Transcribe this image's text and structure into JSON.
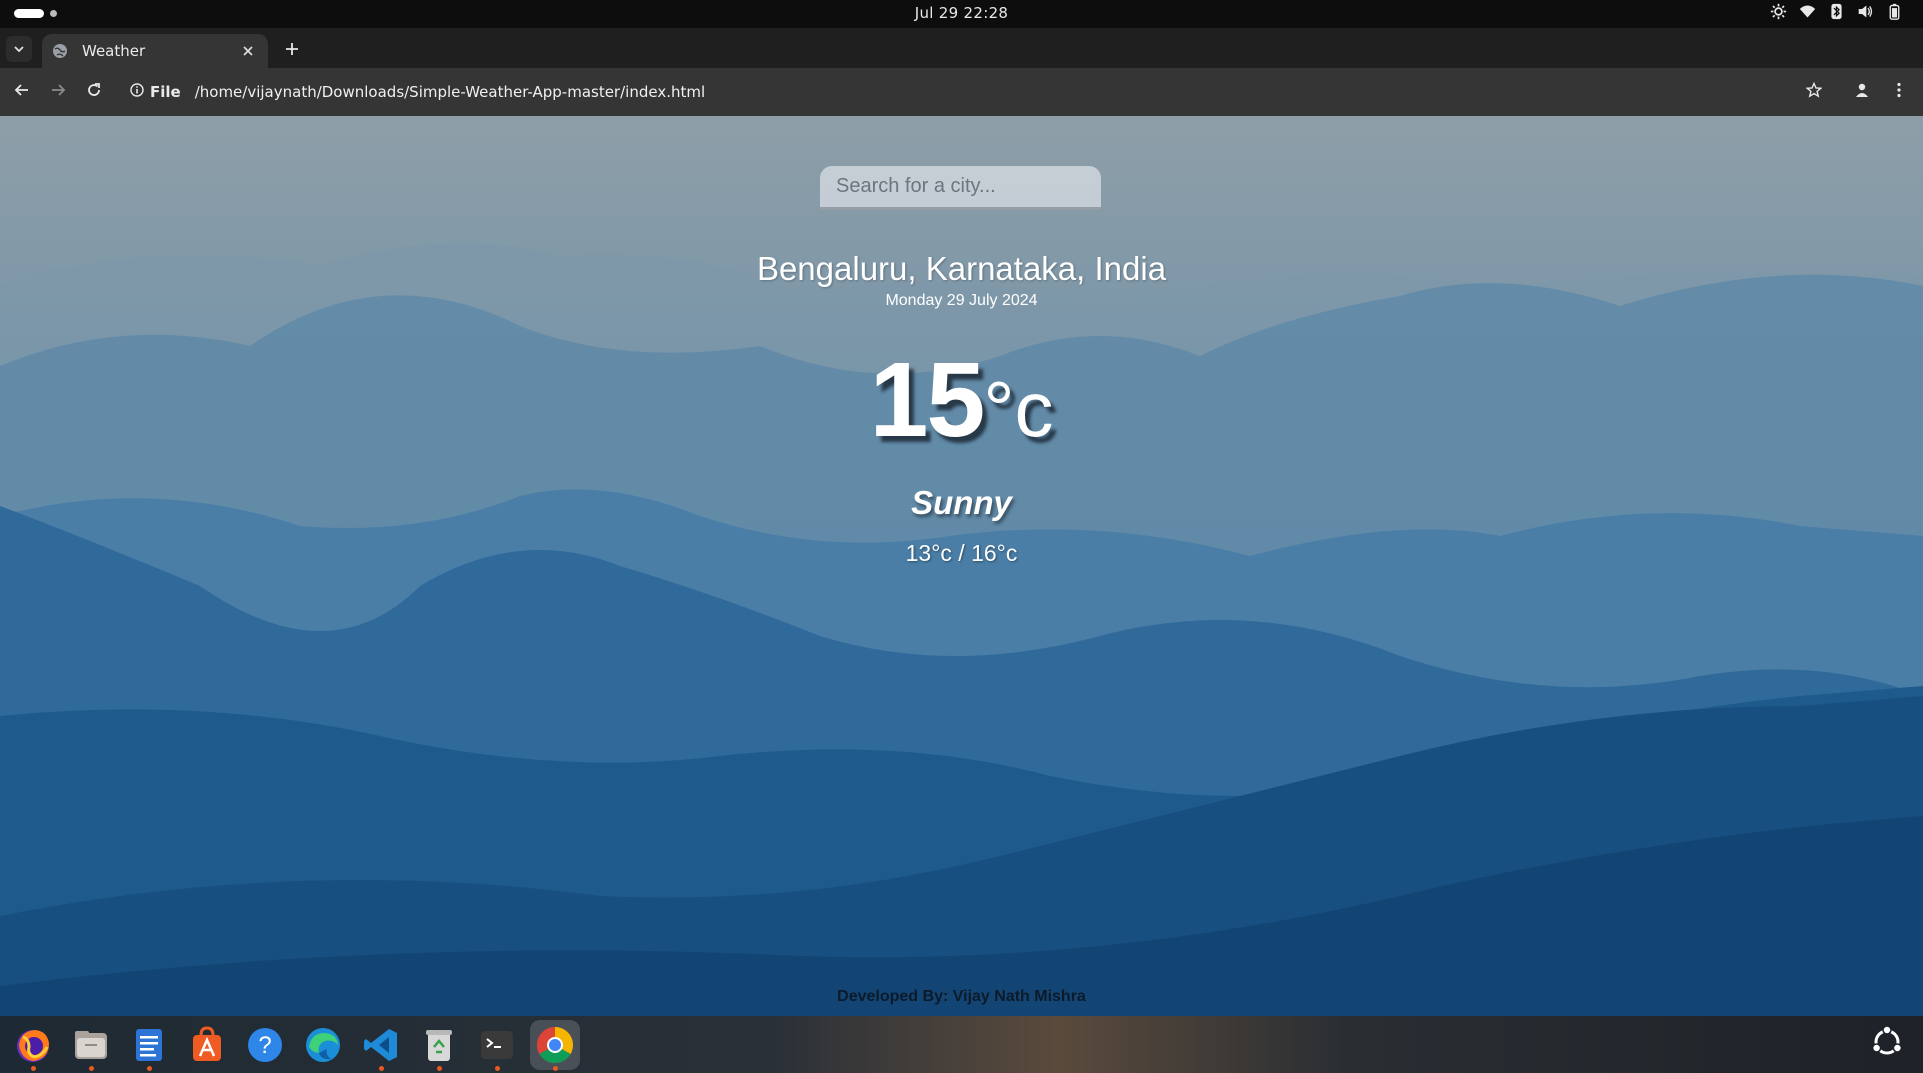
{
  "system_bar": {
    "clock": "Jul 29  22:28",
    "tray_icons": [
      "brightness-icon",
      "wifi-icon",
      "bluetooth-icon",
      "volume-icon",
      "battery-icon"
    ]
  },
  "browser": {
    "tab": {
      "title": "Weather",
      "favicon": "globe-icon"
    },
    "toolbar": {
      "site_info_label": "File",
      "url": "/home/vijaynath/Downloads/Simple-Weather-App-master/index.html"
    }
  },
  "page": {
    "search": {
      "placeholder": "Search for a city..."
    },
    "location": "Bengaluru, Karnataka, India",
    "date": "Monday 29 July 2024",
    "temperature": {
      "value": "15",
      "unit": "°c"
    },
    "condition": "Sunny",
    "hi_low": "13°c / 16°c",
    "footer": "Developed By: Vijay Nath Mishra"
  },
  "dock": {
    "apps": [
      {
        "name": "Firefox",
        "icon": "firefox-icon",
        "running": true
      },
      {
        "name": "Files",
        "icon": "files-icon",
        "running": true
      },
      {
        "name": "Text Editor",
        "icon": "text-editor-icon",
        "running": true
      },
      {
        "name": "App Center",
        "icon": "app-center-icon",
        "running": false
      },
      {
        "name": "Help",
        "icon": "help-icon",
        "running": false
      },
      {
        "name": "Microsoft Edge",
        "icon": "edge-icon",
        "running": false
      },
      {
        "name": "Visual Studio Code",
        "icon": "vscode-icon",
        "running": true
      },
      {
        "name": "Trash",
        "icon": "trash-icon",
        "running": true
      },
      {
        "name": "Terminal",
        "icon": "terminal-icon",
        "running": true
      },
      {
        "name": "Google Chrome",
        "icon": "chrome-icon",
        "running": true,
        "active": true
      }
    ],
    "show_apps_icon": "ubuntu-apps-icon"
  },
  "colors": {
    "sky_top": "#8e9ea8",
    "mountain_deep": "#154b7a",
    "chrome_toolbar": "#353535",
    "tabstrip": "#1f1f1f",
    "running_indicator": "#e85a1e"
  }
}
